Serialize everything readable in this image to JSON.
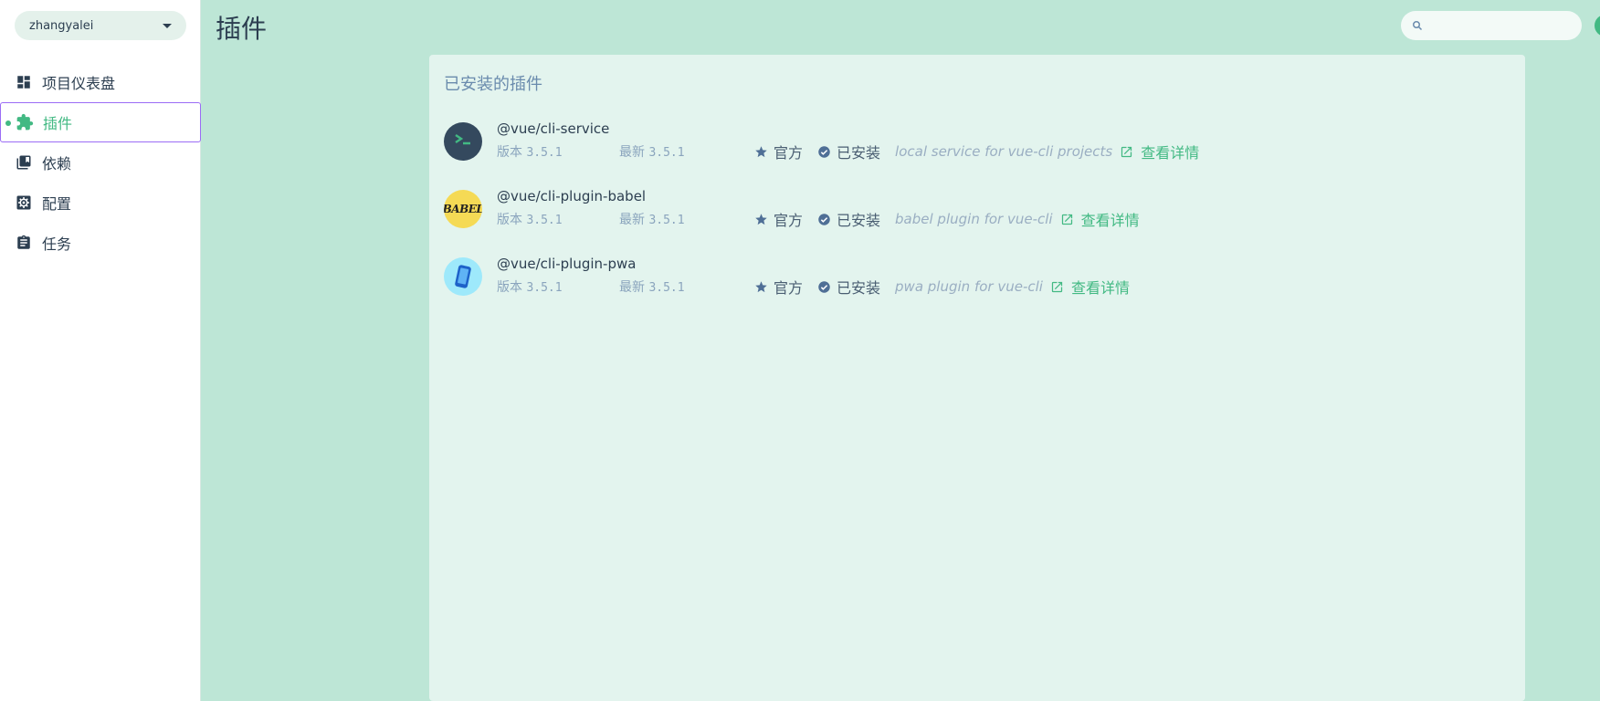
{
  "project": {
    "name": "zhangyalei"
  },
  "nav": {
    "items": [
      {
        "label": "项目仪表盘",
        "icon": "dashboard-icon"
      },
      {
        "label": "插件",
        "icon": "puzzle-icon",
        "active": true
      },
      {
        "label": "依赖",
        "icon": "library-icon"
      },
      {
        "label": "配置",
        "icon": "settings-box-icon"
      },
      {
        "label": "任务",
        "icon": "clipboard-icon"
      }
    ]
  },
  "header": {
    "title": "插件",
    "search_placeholder": ""
  },
  "panel": {
    "title": "已安装的插件",
    "plugins": [
      {
        "name": "@vue/cli-service",
        "version_label": "版本",
        "version": "3.5.1",
        "latest_label": "最新",
        "latest": "3.5.1",
        "official": "官方",
        "installed": "已安装",
        "description": "local service for vue-cli projects",
        "details": "查看详情"
      },
      {
        "name": "@vue/cli-plugin-babel",
        "version_label": "版本",
        "version": "3.5.1",
        "latest_label": "最新",
        "latest": "3.5.1",
        "official": "官方",
        "installed": "已安装",
        "description": "babel plugin for vue-cli",
        "details": "查看详情",
        "logo_text": "BABEL"
      },
      {
        "name": "@vue/cli-plugin-pwa",
        "version_label": "版本",
        "version": "3.5.1",
        "latest_label": "最新",
        "latest": "3.5.1",
        "official": "官方",
        "installed": "已安装",
        "description": "pwa plugin for vue-cli",
        "details": "查看详情"
      }
    ]
  },
  "colors": {
    "accent": "#42b983",
    "background": "#bde6d6",
    "panel": "#e3f4ee",
    "focus": "#9b6cf5"
  }
}
